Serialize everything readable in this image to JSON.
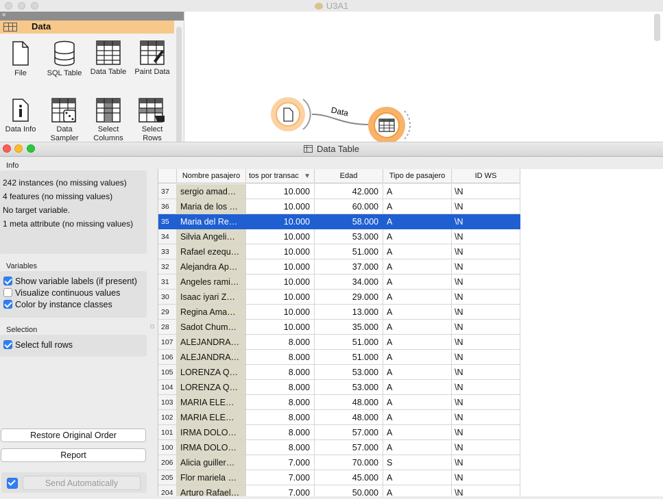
{
  "main_window": {
    "title": "U3A1",
    "category": "Data",
    "collapse_glyph": "«",
    "widgets": [
      {
        "label": "File",
        "icon": "file-icon"
      },
      {
        "label": "SQL Table",
        "icon": "database-icon"
      },
      {
        "label": "Data Table",
        "icon": "table-icon"
      },
      {
        "label": "Paint Data",
        "icon": "paint-data-icon"
      },
      {
        "label": "Data Info",
        "icon": "info-icon"
      },
      {
        "label": "Data Sampler",
        "icon": "dice-table-icon"
      },
      {
        "label": "Select Columns",
        "icon": "select-columns-icon"
      },
      {
        "label": "Select Rows",
        "icon": "select-rows-icon"
      }
    ],
    "link_label": "Data"
  },
  "data_table_window": {
    "title": "Data Table",
    "info": {
      "section": "Info",
      "lines": [
        "242 instances (no missing values)",
        "4 features (no missing values)",
        "No target variable.",
        "1 meta attribute (no missing values)"
      ]
    },
    "variables": {
      "section": "Variables",
      "show_labels": {
        "label": "Show variable labels (if present)",
        "checked": true
      },
      "visualize": {
        "label": "Visualize continuous values",
        "checked": false
      },
      "color_by_class": {
        "label": "Color by instance classes",
        "checked": true
      }
    },
    "selection": {
      "section": "Selection",
      "select_full_rows": {
        "label": "Select full rows",
        "checked": true
      }
    },
    "buttons": {
      "restore": "Restore Original Order",
      "report": "Report",
      "send_auto": "Send Automatically",
      "send_auto_checked": true
    },
    "table": {
      "headers": [
        "Nombre pasajero",
        "tos por transac",
        "Edad",
        "Tipo de pasajero",
        "ID WS"
      ],
      "sort_indicator": "▼",
      "selected_row_index": 2,
      "selection_color": "#1f5fd1",
      "meta_column_color": "#dcd9c7",
      "rows": [
        {
          "idx": "37",
          "name": "sergio amad…",
          "tos": "10.000",
          "edad": "42.000",
          "tipo": "A",
          "id": "\\N"
        },
        {
          "idx": "36",
          "name": "Maria de los …",
          "tos": "10.000",
          "edad": "60.000",
          "tipo": "A",
          "id": "\\N"
        },
        {
          "idx": "35",
          "name": "Maria del Re…",
          "tos": "10.000",
          "edad": "58.000",
          "tipo": "A",
          "id": "\\N"
        },
        {
          "idx": "34",
          "name": "Silvia Angeli…",
          "tos": "10.000",
          "edad": "53.000",
          "tipo": "A",
          "id": "\\N"
        },
        {
          "idx": "33",
          "name": "Rafael ezequ…",
          "tos": "10.000",
          "edad": "51.000",
          "tipo": "A",
          "id": "\\N"
        },
        {
          "idx": "32",
          "name": "Alejandra Ap…",
          "tos": "10.000",
          "edad": "37.000",
          "tipo": "A",
          "id": "\\N"
        },
        {
          "idx": "31",
          "name": "Angeles rami…",
          "tos": "10.000",
          "edad": "34.000",
          "tipo": "A",
          "id": "\\N"
        },
        {
          "idx": "30",
          "name": "Isaac iyari Z…",
          "tos": "10.000",
          "edad": "29.000",
          "tipo": "A",
          "id": "\\N"
        },
        {
          "idx": "29",
          "name": "Regina Ama…",
          "tos": "10.000",
          "edad": "13.000",
          "tipo": "A",
          "id": "\\N"
        },
        {
          "idx": "28",
          "name": "Sadot Chum…",
          "tos": "10.000",
          "edad": "35.000",
          "tipo": "A",
          "id": "\\N"
        },
        {
          "idx": "107",
          "name": "ALEJANDRA…",
          "tos": "8.000",
          "edad": "51.000",
          "tipo": "A",
          "id": "\\N"
        },
        {
          "idx": "106",
          "name": "ALEJANDRA…",
          "tos": "8.000",
          "edad": "51.000",
          "tipo": "A",
          "id": "\\N"
        },
        {
          "idx": "105",
          "name": "LORENZA Q…",
          "tos": "8.000",
          "edad": "53.000",
          "tipo": "A",
          "id": "\\N"
        },
        {
          "idx": "104",
          "name": "LORENZA Q…",
          "tos": "8.000",
          "edad": "53.000",
          "tipo": "A",
          "id": "\\N"
        },
        {
          "idx": "103",
          "name": "MARIA ELE…",
          "tos": "8.000",
          "edad": "48.000",
          "tipo": "A",
          "id": "\\N"
        },
        {
          "idx": "102",
          "name": "MARIA ELE…",
          "tos": "8.000",
          "edad": "48.000",
          "tipo": "A",
          "id": "\\N"
        },
        {
          "idx": "101",
          "name": "IRMA DOLO…",
          "tos": "8.000",
          "edad": "57.000",
          "tipo": "A",
          "id": "\\N"
        },
        {
          "idx": "100",
          "name": "IRMA DOLO…",
          "tos": "8.000",
          "edad": "57.000",
          "tipo": "A",
          "id": "\\N"
        },
        {
          "idx": "206",
          "name": "Alicia guiller…",
          "tos": "7.000",
          "edad": "70.000",
          "tipo": "S",
          "id": "\\N"
        },
        {
          "idx": "205",
          "name": "Flor mariela …",
          "tos": "7.000",
          "edad": "45.000",
          "tipo": "A",
          "id": "\\N"
        },
        {
          "idx": "204",
          "name": "Arturo Rafael…",
          "tos": "7.000",
          "edad": "50.000",
          "tipo": "A",
          "id": "\\N"
        }
      ]
    }
  }
}
